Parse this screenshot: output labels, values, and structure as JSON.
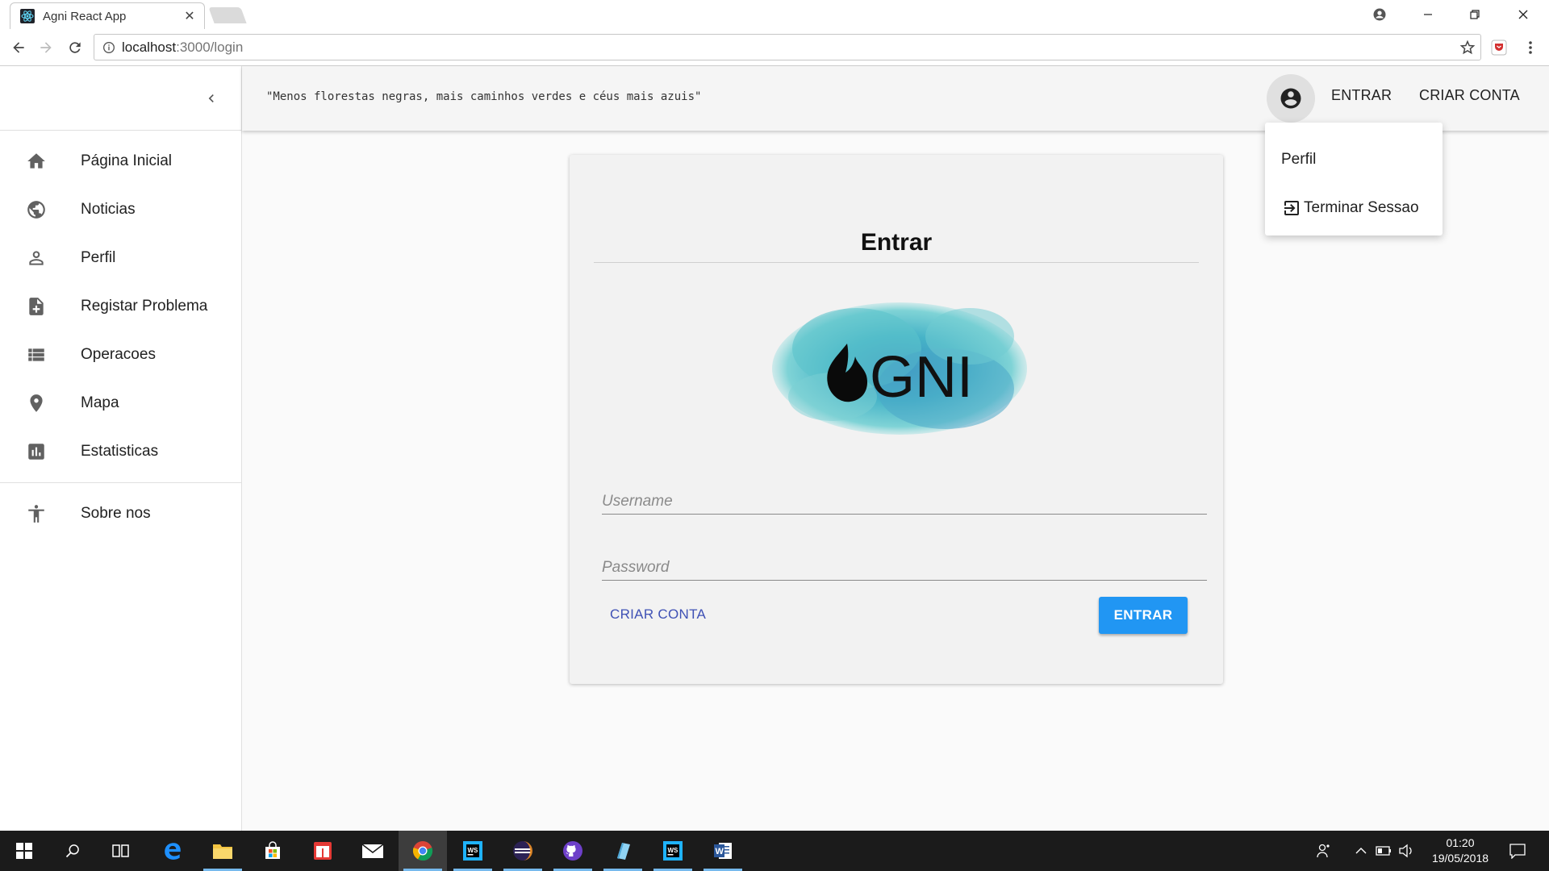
{
  "browser": {
    "tab_title": "Agni React App",
    "url_host": "localhost",
    "url_path": ":3000/login"
  },
  "sidebar": {
    "items": [
      {
        "label": "Página Inicial",
        "icon": "home-icon"
      },
      {
        "label": "Noticias",
        "icon": "globe-icon"
      },
      {
        "label": "Perfil",
        "icon": "person-icon"
      },
      {
        "label": "Registar Problema",
        "icon": "note-add-icon"
      },
      {
        "label": "Operacoes",
        "icon": "list-icon"
      },
      {
        "label": "Mapa",
        "icon": "location-pin-icon"
      },
      {
        "label": "Estatisticas",
        "icon": "bar-chart-icon"
      }
    ],
    "secondary_items": [
      {
        "label": "Sobre nos",
        "icon": "accessibility-icon"
      }
    ]
  },
  "appbar": {
    "quote": "\"Menos florestas negras, mais caminhos verdes e céus mais azuis\"",
    "login_label": "ENTRAR",
    "signup_label": "CRIAR CONTA"
  },
  "account_menu": {
    "items": [
      {
        "label": "Perfil"
      },
      {
        "label": "Terminar Sessao",
        "icon": "exit-icon"
      }
    ]
  },
  "login_card": {
    "title": "Entrar",
    "logo_text": "GNI",
    "username_placeholder": "Username",
    "password_placeholder": "Password",
    "signup_label": "CRIAR CONTA",
    "submit_label": "ENTRAR"
  },
  "taskbar": {
    "time": "01:20",
    "date": "19/05/2018"
  },
  "colors": {
    "primary": "#2196f3",
    "link": "#3f51b5",
    "logo_cloud": "#4fc3c9"
  }
}
